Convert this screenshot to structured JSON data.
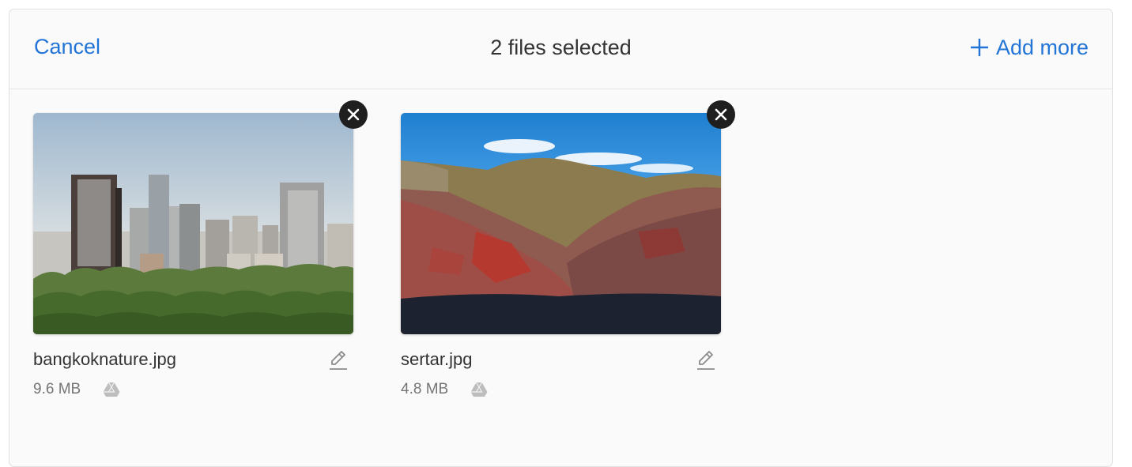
{
  "header": {
    "cancel_label": "Cancel",
    "title": "2 files selected",
    "add_more_label": "Add more"
  },
  "files": [
    {
      "name": "bangkoknature.jpg",
      "size": "9.6 MB",
      "source_icon": "google-drive-icon",
      "preview": "city skyline above a green park"
    },
    {
      "name": "sertar.jpg",
      "size": "4.8 MB",
      "source_icon": "google-drive-icon",
      "preview": "hillside covered with red houses under blue sky"
    }
  ],
  "colors": {
    "accent": "#2275d7",
    "panel_bg": "#fafafa",
    "text": "#333333",
    "muted": "#757575",
    "remove_bg": "#1f1f1f"
  }
}
